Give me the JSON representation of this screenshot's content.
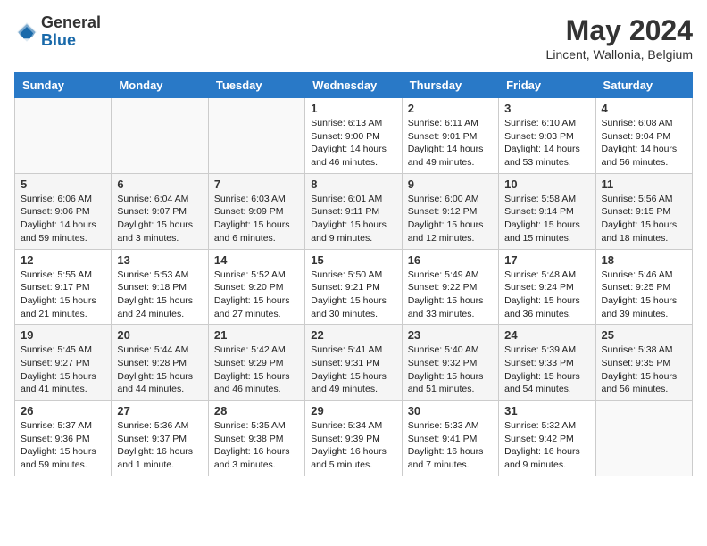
{
  "header": {
    "logo": {
      "general": "General",
      "blue": "Blue"
    },
    "title": "May 2024",
    "location": "Lincent, Wallonia, Belgium"
  },
  "weekdays": [
    "Sunday",
    "Monday",
    "Tuesday",
    "Wednesday",
    "Thursday",
    "Friday",
    "Saturday"
  ],
  "weeks": [
    [
      {
        "day": "",
        "info": ""
      },
      {
        "day": "",
        "info": ""
      },
      {
        "day": "",
        "info": ""
      },
      {
        "day": "1",
        "info": "Sunrise: 6:13 AM\nSunset: 9:00 PM\nDaylight: 14 hours and 46 minutes."
      },
      {
        "day": "2",
        "info": "Sunrise: 6:11 AM\nSunset: 9:01 PM\nDaylight: 14 hours and 49 minutes."
      },
      {
        "day": "3",
        "info": "Sunrise: 6:10 AM\nSunset: 9:03 PM\nDaylight: 14 hours and 53 minutes."
      },
      {
        "day": "4",
        "info": "Sunrise: 6:08 AM\nSunset: 9:04 PM\nDaylight: 14 hours and 56 minutes."
      }
    ],
    [
      {
        "day": "5",
        "info": "Sunrise: 6:06 AM\nSunset: 9:06 PM\nDaylight: 14 hours and 59 minutes."
      },
      {
        "day": "6",
        "info": "Sunrise: 6:04 AM\nSunset: 9:07 PM\nDaylight: 15 hours and 3 minutes."
      },
      {
        "day": "7",
        "info": "Sunrise: 6:03 AM\nSunset: 9:09 PM\nDaylight: 15 hours and 6 minutes."
      },
      {
        "day": "8",
        "info": "Sunrise: 6:01 AM\nSunset: 9:11 PM\nDaylight: 15 hours and 9 minutes."
      },
      {
        "day": "9",
        "info": "Sunrise: 6:00 AM\nSunset: 9:12 PM\nDaylight: 15 hours and 12 minutes."
      },
      {
        "day": "10",
        "info": "Sunrise: 5:58 AM\nSunset: 9:14 PM\nDaylight: 15 hours and 15 minutes."
      },
      {
        "day": "11",
        "info": "Sunrise: 5:56 AM\nSunset: 9:15 PM\nDaylight: 15 hours and 18 minutes."
      }
    ],
    [
      {
        "day": "12",
        "info": "Sunrise: 5:55 AM\nSunset: 9:17 PM\nDaylight: 15 hours and 21 minutes."
      },
      {
        "day": "13",
        "info": "Sunrise: 5:53 AM\nSunset: 9:18 PM\nDaylight: 15 hours and 24 minutes."
      },
      {
        "day": "14",
        "info": "Sunrise: 5:52 AM\nSunset: 9:20 PM\nDaylight: 15 hours and 27 minutes."
      },
      {
        "day": "15",
        "info": "Sunrise: 5:50 AM\nSunset: 9:21 PM\nDaylight: 15 hours and 30 minutes."
      },
      {
        "day": "16",
        "info": "Sunrise: 5:49 AM\nSunset: 9:22 PM\nDaylight: 15 hours and 33 minutes."
      },
      {
        "day": "17",
        "info": "Sunrise: 5:48 AM\nSunset: 9:24 PM\nDaylight: 15 hours and 36 minutes."
      },
      {
        "day": "18",
        "info": "Sunrise: 5:46 AM\nSunset: 9:25 PM\nDaylight: 15 hours and 39 minutes."
      }
    ],
    [
      {
        "day": "19",
        "info": "Sunrise: 5:45 AM\nSunset: 9:27 PM\nDaylight: 15 hours and 41 minutes."
      },
      {
        "day": "20",
        "info": "Sunrise: 5:44 AM\nSunset: 9:28 PM\nDaylight: 15 hours and 44 minutes."
      },
      {
        "day": "21",
        "info": "Sunrise: 5:42 AM\nSunset: 9:29 PM\nDaylight: 15 hours and 46 minutes."
      },
      {
        "day": "22",
        "info": "Sunrise: 5:41 AM\nSunset: 9:31 PM\nDaylight: 15 hours and 49 minutes."
      },
      {
        "day": "23",
        "info": "Sunrise: 5:40 AM\nSunset: 9:32 PM\nDaylight: 15 hours and 51 minutes."
      },
      {
        "day": "24",
        "info": "Sunrise: 5:39 AM\nSunset: 9:33 PM\nDaylight: 15 hours and 54 minutes."
      },
      {
        "day": "25",
        "info": "Sunrise: 5:38 AM\nSunset: 9:35 PM\nDaylight: 15 hours and 56 minutes."
      }
    ],
    [
      {
        "day": "26",
        "info": "Sunrise: 5:37 AM\nSunset: 9:36 PM\nDaylight: 15 hours and 59 minutes."
      },
      {
        "day": "27",
        "info": "Sunrise: 5:36 AM\nSunset: 9:37 PM\nDaylight: 16 hours and 1 minute."
      },
      {
        "day": "28",
        "info": "Sunrise: 5:35 AM\nSunset: 9:38 PM\nDaylight: 16 hours and 3 minutes."
      },
      {
        "day": "29",
        "info": "Sunrise: 5:34 AM\nSunset: 9:39 PM\nDaylight: 16 hours and 5 minutes."
      },
      {
        "day": "30",
        "info": "Sunrise: 5:33 AM\nSunset: 9:41 PM\nDaylight: 16 hours and 7 minutes."
      },
      {
        "day": "31",
        "info": "Sunrise: 5:32 AM\nSunset: 9:42 PM\nDaylight: 16 hours and 9 minutes."
      },
      {
        "day": "",
        "info": ""
      }
    ]
  ]
}
